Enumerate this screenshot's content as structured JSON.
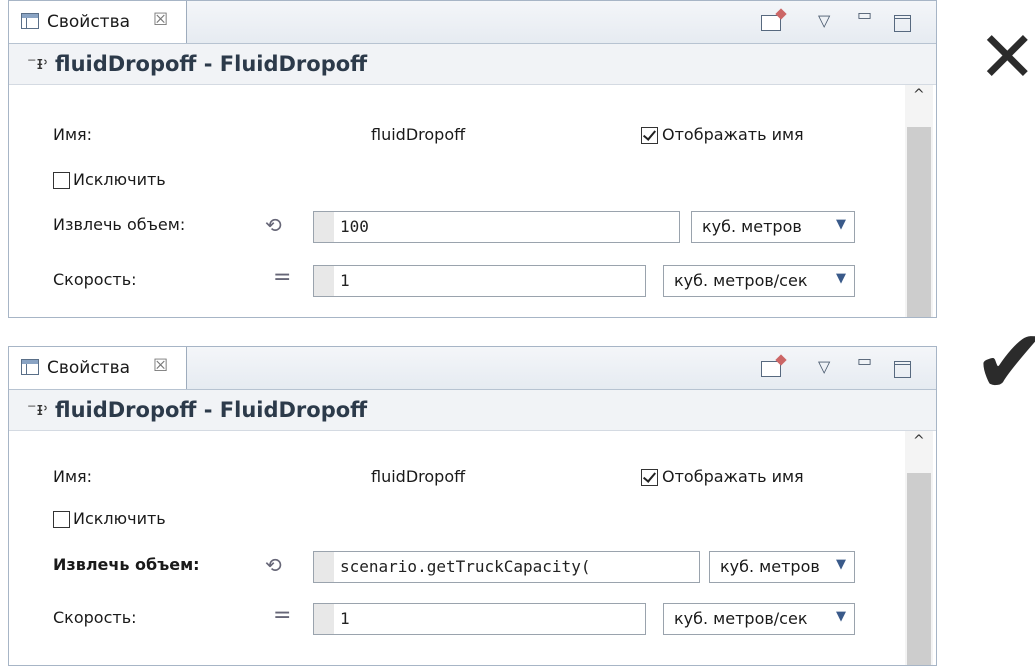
{
  "panels": [
    {
      "tab": {
        "title": "Свойства",
        "close_glyph": "☒"
      },
      "object_title": "fluidDropoff - FluidDropoff",
      "name_label": "Имя:",
      "name_value": "fluidDropoff",
      "show_name_label": "Отображать имя",
      "show_name_checked": true,
      "exclude_label": "Исключить",
      "exclude_checked": false,
      "volume_label": "Извлечь объем:",
      "volume_label_bold": false,
      "volume_value": "100",
      "volume_unit": "куб. метров",
      "speed_label": "Скорость:",
      "speed_value": "1",
      "speed_unit": "куб. метров/сек"
    },
    {
      "tab": {
        "title": "Свойства",
        "close_glyph": "☒"
      },
      "object_title": "fluidDropoff - FluidDropoff",
      "name_label": "Имя:",
      "name_value": "fluidDropoff",
      "show_name_label": "Отображать имя",
      "show_name_checked": true,
      "exclude_label": "Исключить",
      "exclude_checked": false,
      "volume_label": "Извлечь объем:",
      "volume_label_bold": true,
      "volume_value": "scenario.getTruckCapacity(",
      "volume_unit": "куб. метров",
      "speed_label": "Скорость:",
      "speed_value": "1",
      "speed_unit": "куб. метров/сек"
    }
  ],
  "marks": {
    "wrong": "✕",
    "right": "✔"
  },
  "icons": {
    "tab": "properties-icon",
    "object": "fluid-dropoff-icon",
    "mode": "dynamic-value-icon",
    "equals": "static-value-icon"
  }
}
